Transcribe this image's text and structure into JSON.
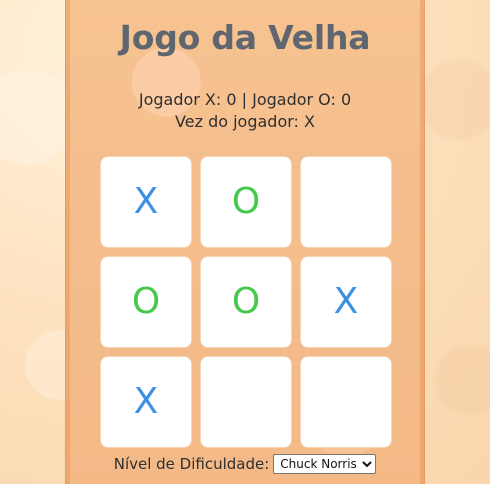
{
  "header": {
    "title": "Jogo da Velha"
  },
  "status": {
    "score": "Jogador X: 0 | Jogador O: 0",
    "turn": "Vez do jogador: X"
  },
  "board": {
    "cells": [
      "X",
      "O",
      "",
      "O",
      "O",
      "X",
      "X",
      "",
      ""
    ]
  },
  "difficulty": {
    "label": "Nível de Dificuldade:",
    "selected": "Chuck Norris"
  },
  "colors": {
    "x_mark": "#3d8fe3",
    "o_mark": "#46c94b",
    "title_text": "#5f6670",
    "panel_background": "#f5be8e",
    "page_background": "#fde0bc",
    "cell_background": "#ffffff"
  }
}
